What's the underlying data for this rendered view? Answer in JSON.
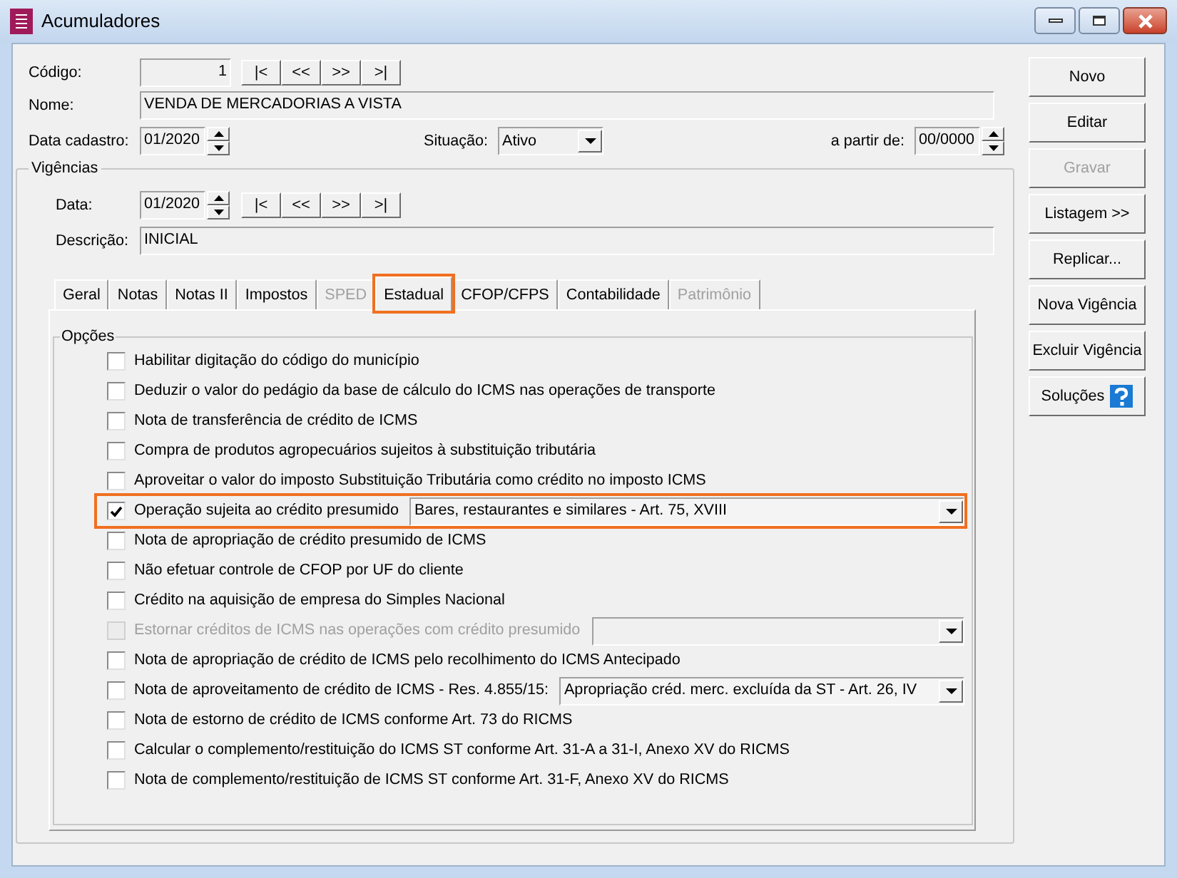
{
  "window": {
    "title": "Acumuladores"
  },
  "header": {
    "codigo_label": "Código:",
    "codigo": "1",
    "nome_label": "Nome:",
    "nome": "VENDA DE MERCADORIAS A VISTA",
    "data_label": "Data cadastro:",
    "data": "01/2020",
    "situacao_label": "Situação:",
    "situacao": "Ativo",
    "partir_label": "a partir de:",
    "partir": "00/0000"
  },
  "nav_buttons": [
    "|<",
    "<<",
    ">>",
    ">|"
  ],
  "vigencias": {
    "title": "Vigências",
    "data_label": "Data:",
    "data": "01/2020",
    "nav_buttons": [
      "|<",
      "<<",
      ">>",
      ">|"
    ],
    "descricao_label": "Descrição:",
    "descricao": "INICIAL"
  },
  "tabs": [
    {
      "label": "Geral",
      "selected": false,
      "disabled": false,
      "highlighted": false
    },
    {
      "label": "Notas",
      "selected": false,
      "disabled": false,
      "highlighted": false
    },
    {
      "label": "Notas II",
      "selected": false,
      "disabled": false,
      "highlighted": false
    },
    {
      "label": "Impostos",
      "selected": false,
      "disabled": false,
      "highlighted": false
    },
    {
      "label": "SPED",
      "selected": false,
      "disabled": true,
      "highlighted": false
    },
    {
      "label": "Estadual",
      "selected": true,
      "disabled": false,
      "highlighted": true
    },
    {
      "label": "CFOP/CFPS",
      "selected": false,
      "disabled": false,
      "highlighted": false
    },
    {
      "label": "Contabilidade",
      "selected": false,
      "disabled": false,
      "highlighted": false
    },
    {
      "label": "Patrimônio",
      "selected": false,
      "disabled": true,
      "highlighted": false
    }
  ],
  "options_title": "Opções",
  "options": [
    {
      "kind": "checkbox",
      "label": "Habilitar digitação do código do município",
      "checked": false,
      "disabled": false,
      "highlighted": false
    },
    {
      "kind": "checkbox",
      "label": "Deduzir o valor do pedágio da base de cálculo do ICMS nas operações de transporte",
      "checked": false,
      "disabled": false,
      "highlighted": false
    },
    {
      "kind": "checkbox",
      "label": "Nota de transferência de crédito de ICMS",
      "checked": false,
      "disabled": false,
      "highlighted": false
    },
    {
      "kind": "checkbox",
      "label": "Compra de produtos agropecuários sujeitos à substituição tributária",
      "checked": false,
      "disabled": false,
      "highlighted": false
    },
    {
      "kind": "checkbox",
      "label": "Aproveitar o valor do imposto Substituição Tributária como crédito no imposto ICMS",
      "checked": false,
      "disabled": false,
      "highlighted": false
    },
    {
      "kind": "checkbox-select",
      "label": "Operação sujeita ao crédito presumido",
      "checked": true,
      "disabled": false,
      "highlighted": true,
      "value": "Bares, restaurantes e similares - Art. 75, XVIII"
    },
    {
      "kind": "checkbox",
      "label": "Nota de apropriação de crédito presumido de ICMS",
      "checked": false,
      "disabled": false,
      "highlighted": false
    },
    {
      "kind": "checkbox",
      "label": "Não efetuar controle de CFOP por UF do cliente",
      "checked": false,
      "disabled": false,
      "highlighted": false
    },
    {
      "kind": "checkbox",
      "label": "Crédito na aquisição de empresa do Simples Nacional",
      "checked": false,
      "disabled": false,
      "highlighted": false
    },
    {
      "kind": "checkbox-select",
      "label": "Estornar créditos de ICMS nas operações com crédito presumido",
      "checked": false,
      "disabled": true,
      "highlighted": false
    },
    {
      "kind": "checkbox",
      "label": "Nota de apropriação de crédito de ICMS pelo recolhimento do ICMS Antecipado",
      "checked": false,
      "disabled": false,
      "highlighted": false
    },
    {
      "kind": "checkbox-select",
      "label": "Nota de aproveitamento de crédito de ICMS - Res. 4.855/15:",
      "checked": false,
      "disabled": false,
      "highlighted": false,
      "value": "Apropriação créd. merc. excluída da ST - Art. 26, IV"
    },
    {
      "kind": "checkbox",
      "label": "Nota de estorno de crédito de ICMS conforme Art. 73 do RICMS",
      "checked": false,
      "disabled": false,
      "highlighted": false
    },
    {
      "kind": "checkbox",
      "label": "Calcular o complemento/restituição do ICMS ST conforme Art. 31-A a 31-I, Anexo XV do RICMS",
      "checked": false,
      "disabled": false,
      "highlighted": false
    },
    {
      "kind": "checkbox",
      "label": "Nota de complemento/restituição de ICMS ST conforme Art. 31-F, Anexo XV do RICMS",
      "checked": false,
      "disabled": false,
      "highlighted": false
    }
  ],
  "side_buttons": [
    {
      "kind": "plain",
      "label": "Novo",
      "disabled": false
    },
    {
      "kind": "plain",
      "label": "Editar",
      "disabled": false
    },
    {
      "kind": "plain",
      "label": "Gravar",
      "disabled": true
    },
    {
      "kind": "plain",
      "label": "Listagem >>",
      "disabled": false
    },
    {
      "kind": "plain",
      "label": "Replicar...",
      "disabled": false
    },
    {
      "kind": "plain",
      "label": "Nova Vigência",
      "disabled": false
    },
    {
      "kind": "plain",
      "label": "Excluir Vigência",
      "disabled": false
    },
    {
      "kind": "help",
      "label": "Soluções",
      "disabled": false
    }
  ]
}
